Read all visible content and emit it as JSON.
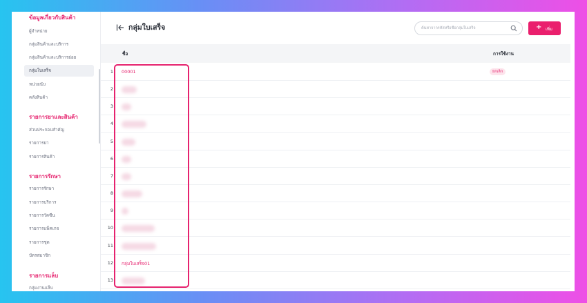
{
  "sidebar": {
    "sections": [
      {
        "title": "ข้อมูลเกี่ยวกับสินค้า",
        "items": [
          "ผู้จำหน่าย",
          "กลุ่มสินค้าและบริการ",
          "กลุ่มสินค้าและบริการย่อย",
          "กลุ่มใบเสร็จ",
          "หน่วยนับ",
          "คลังสินค้า"
        ]
      },
      {
        "title": "รายการยาและสินค้า",
        "items": [
          "ส่วนประกอบสำคัญ",
          "รายการยา",
          "รายการสินค้า"
        ]
      },
      {
        "title": "รายการรักษา",
        "items": [
          "รายการรักษา",
          "รายการบริการ",
          "รายการวัคซีน",
          "รายการแพ็คเกจ",
          "รายการชุด",
          "บัตรสมาชิก"
        ]
      },
      {
        "title": "รายการแล็บ",
        "items": [
          "กลุ่มงานแล็บ"
        ]
      }
    ],
    "active_item": "กลุ่มใบเสร็จ"
  },
  "header": {
    "title": "กลุ่มใบเสร็จ",
    "search_placeholder": "ค้นหาจากรหัสหรือชื่อกลุ่มใบเสร็จ",
    "add_label": "เพิ่ม"
  },
  "table": {
    "columns": [
      "ชื่อ",
      "การใช้งาน"
    ],
    "rows": [
      {
        "num": "1",
        "name": "00001",
        "status": "ยกเลิก"
      },
      {
        "num": "2",
        "name": "",
        "status": ""
      },
      {
        "num": "3",
        "name": "",
        "status": ""
      },
      {
        "num": "4",
        "name": "",
        "status": ""
      },
      {
        "num": "5",
        "name": "",
        "status": ""
      },
      {
        "num": "6",
        "name": "",
        "status": ""
      },
      {
        "num": "7",
        "name": "",
        "status": ""
      },
      {
        "num": "8",
        "name": "",
        "status": ""
      },
      {
        "num": "9",
        "name": "",
        "status": ""
      },
      {
        "num": "10",
        "name": "",
        "status": ""
      },
      {
        "num": "11",
        "name": "",
        "status": ""
      },
      {
        "num": "12",
        "name": "กลุ่มใบเสร็จ01",
        "status": ""
      },
      {
        "num": "13",
        "name": "",
        "status": ""
      }
    ]
  },
  "colors": {
    "accent": "#e51e6b",
    "button": "#ea1f6d",
    "highlight": "#e6226e"
  }
}
